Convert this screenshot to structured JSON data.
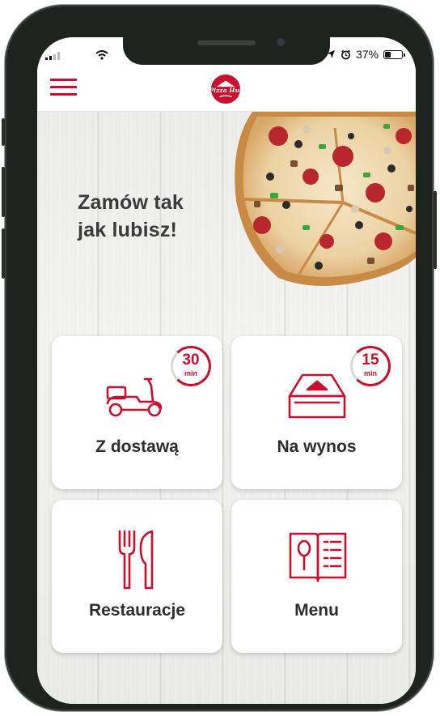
{
  "status_bar": {
    "battery": "37%",
    "battery_level": 0.37
  },
  "app_bar": {
    "menu_icon": "hamburger-menu-icon",
    "logo_icon": "pizza-hut-logo",
    "logo_text": "Pizza Hut"
  },
  "hero": {
    "headline_line1": "Zamów tak",
    "headline_line2": "jak lubisz!",
    "image_icon": "pizza-image"
  },
  "tiles": [
    {
      "label": "Z dostawą",
      "icon": "scooter-icon",
      "time": "30",
      "time_unit": "min"
    },
    {
      "label": "Na wynos",
      "icon": "pizza-box-icon",
      "time": "15",
      "time_unit": "min"
    },
    {
      "label": "Restauracje",
      "icon": "fork-knife-icon"
    },
    {
      "label": "Menu",
      "icon": "menu-book-icon"
    }
  ],
  "colors": {
    "accent": "#c8102e",
    "text": "#2e2e2e",
    "tile_bg": "#ffffff"
  }
}
